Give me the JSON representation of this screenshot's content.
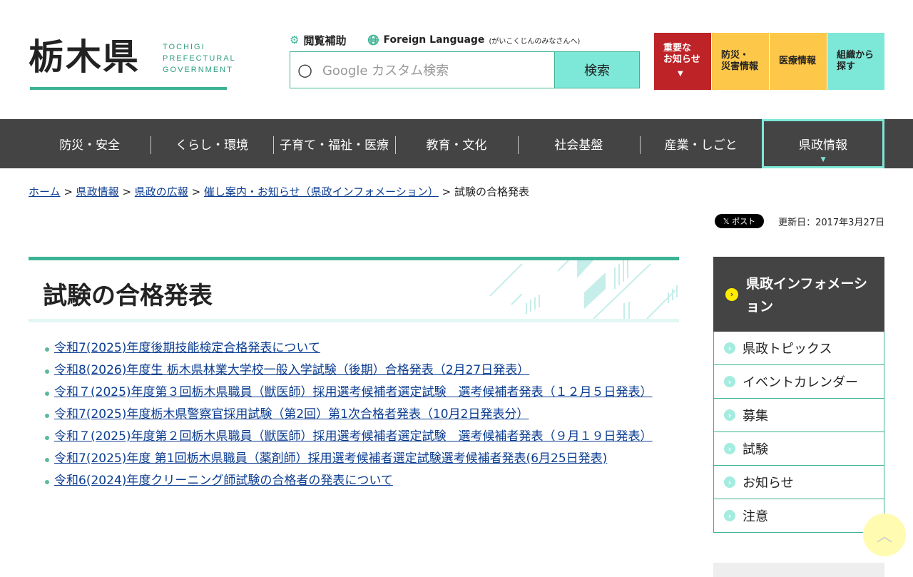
{
  "logo": {
    "kanji": "栃木県",
    "en": [
      "TOCHIGI",
      "PREFECTURAL",
      "GOVERNMENT"
    ]
  },
  "util": {
    "accessibility": "閲覧補助",
    "foreign": "Foreign Language",
    "foreign_sub": "(がいこくじんのみなさんへ)"
  },
  "search": {
    "placeholder": "Google カスタム検索",
    "button": "検索"
  },
  "quick": [
    {
      "l1": "重要な",
      "l2": "お知らせ"
    },
    {
      "l1": "防災・",
      "l2": "災害情報"
    },
    {
      "l1": "医療情報",
      "l2": ""
    },
    {
      "l1": "組織から",
      "l2": "探す"
    }
  ],
  "nav": [
    "防災・安全",
    "くらし・環境",
    "子育て・福祉・医療",
    "教育・文化",
    "社会基盤",
    "産業・しごと",
    "県政情報"
  ],
  "breadcrumb": [
    "ホーム",
    "県政情報",
    "県政の広報",
    "催し案内・お知らせ（県政インフォメーション）"
  ],
  "breadcrumb_current": "試験の合格発表",
  "x_post": "𝕏 ポスト",
  "updated": "更新日：2017年3月27日",
  "title": "試験の合格発表",
  "items": [
    "令和7(2025)年度後期技能検定合格発表について",
    "令和8(2026)年度生 栃木県林業大学校一般入学試験（後期）合格発表（2月27日発表）",
    "令和７(2025)年度第３回栃木県職員（獣医師）採用選考候補者選定試験　選考候補者発表（１２月５日発表）",
    "令和7(2025)年度栃木県警察官採用試験（第2回）第1次合格者発表（10月2日発表分）",
    "令和７(2025)年度第２回栃木県職員（獣医師）採用選考候補者選定試験　選考候補者発表（９月１９日発表）",
    "令和7(2025)年度 第1回栃木県職員（薬剤師）採用選考候補者選定試験選考候補者発表(6月25日発表)",
    "令和6(2024)年度クリーニング師試験の合格者の発表について"
  ],
  "side": {
    "heading": "県政インフォメーション",
    "items": [
      "県政トピックス",
      "イベントカレンダー",
      "募集",
      "試験",
      "お知らせ",
      "注意"
    ]
  }
}
